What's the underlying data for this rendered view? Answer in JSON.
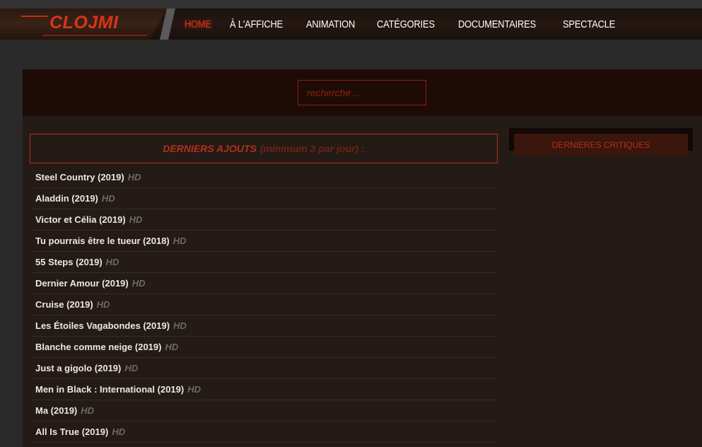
{
  "brand": {
    "logo_text": "CLOJMI"
  },
  "nav": {
    "items": [
      {
        "label": "HOME",
        "active": true
      },
      {
        "label": "À L'AFFICHE",
        "active": false
      },
      {
        "label": "ANIMATION",
        "active": false
      },
      {
        "label": "CATÉGORIES",
        "active": false
      },
      {
        "label": "DOCUMENTAIRES",
        "active": false
      },
      {
        "label": "SPECTACLE",
        "active": false
      }
    ]
  },
  "search": {
    "placeholder": "recherche ..."
  },
  "latest": {
    "heading": "DERNIERS AJOUTS",
    "note": "(minimum 3 par jour) :",
    "items": [
      {
        "title": "Steel Country (2019)",
        "quality": "HD"
      },
      {
        "title": "Aladdin (2019)",
        "quality": "HD"
      },
      {
        "title": "Victor et Célia (2019)",
        "quality": "HD"
      },
      {
        "title": "Tu pourrais être le tueur (2018)",
        "quality": "HD"
      },
      {
        "title": "55 Steps (2019)",
        "quality": "HD"
      },
      {
        "title": "Dernier Amour (2019)",
        "quality": "HD"
      },
      {
        "title": "Cruise (2019)",
        "quality": "HD"
      },
      {
        "title": "Les Étoiles Vagabondes (2019)",
        "quality": "HD"
      },
      {
        "title": "Blanche comme neige (2019)",
        "quality": "HD"
      },
      {
        "title": "Just a gigolo (2019)",
        "quality": "HD"
      },
      {
        "title": "Men in Black : International (2019)",
        "quality": "HD"
      },
      {
        "title": "Ma (2019)",
        "quality": "HD"
      },
      {
        "title": "All Is True (2019)",
        "quality": "HD"
      }
    ]
  },
  "sidebar": {
    "title": "DERNIERES CRITIQUES"
  },
  "colors": {
    "accent": "#d9341a",
    "background": "#2a2a2a",
    "panel": "#241a16"
  }
}
